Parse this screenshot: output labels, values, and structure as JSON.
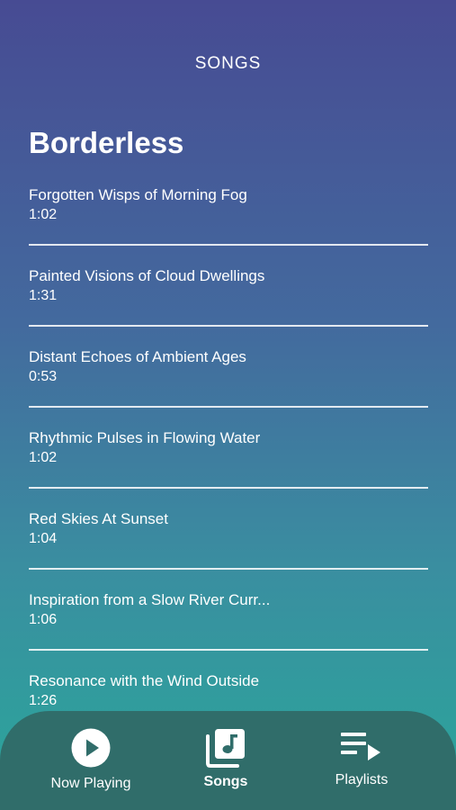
{
  "header": {
    "title": "SONGS"
  },
  "album": {
    "title": "Borderless"
  },
  "songs": [
    {
      "title": "Forgotten Wisps of Morning Fog",
      "duration": "1:02"
    },
    {
      "title": "Painted Visions of Cloud Dwellings",
      "duration": "1:31"
    },
    {
      "title": "Distant Echoes of Ambient Ages",
      "duration": "0:53"
    },
    {
      "title": "Rhythmic Pulses in Flowing Water",
      "duration": "1:02"
    },
    {
      "title": "Red Skies At Sunset",
      "duration": "1:04"
    },
    {
      "title": "Inspiration from a Slow River Curr...",
      "duration": "1:06"
    },
    {
      "title": "Resonance with the Wind Outside",
      "duration": "1:26"
    }
  ],
  "nav": {
    "now_playing": {
      "label": "Now Playing",
      "icon": "play-circle-icon"
    },
    "songs": {
      "label": "Songs",
      "icon": "music-library-icon",
      "active": true
    },
    "playlists": {
      "label": "Playlists",
      "icon": "playlist-play-icon"
    }
  },
  "colors": {
    "gradient_top": "#474b93",
    "gradient_bottom": "#2aa79b",
    "nav_background": "#306d6a",
    "text": "#ffffff"
  }
}
